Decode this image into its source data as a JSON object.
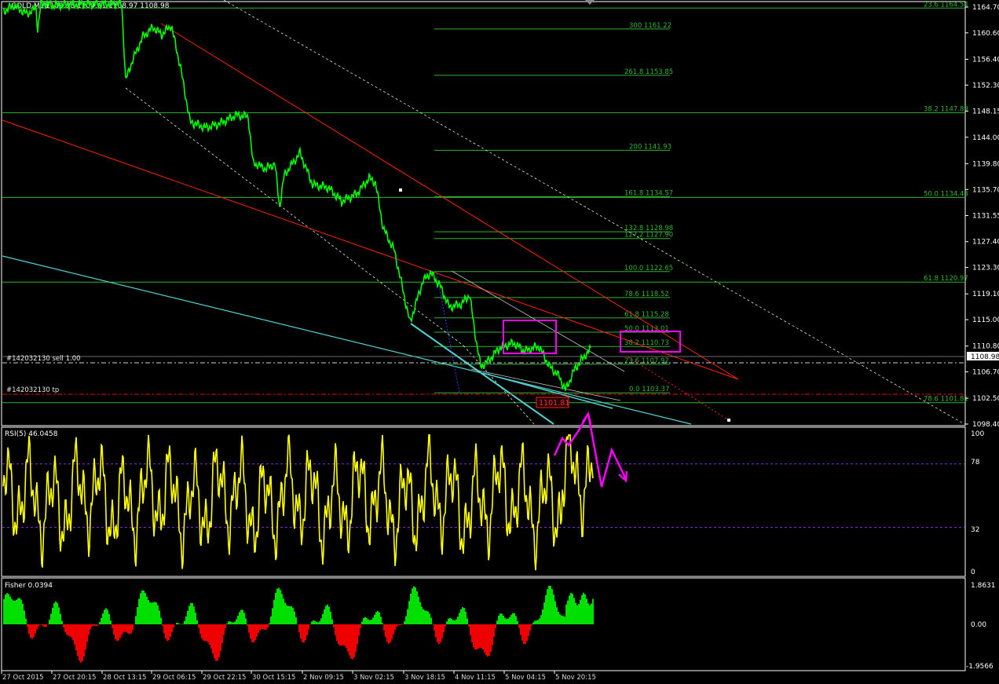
{
  "header": {
    "symbol": "GOLD,M15",
    "ohlc": "1109.38 1109.61 1108.97 1108.98"
  },
  "price_axis": {
    "ticks": [
      "1164.70",
      "1160.60",
      "1156.40",
      "1152.30",
      "1148.15",
      "1144.00",
      "1139.80",
      "1135.70",
      "1131.55",
      "1127.40",
      "1123.30",
      "1119.10",
      "1115.00",
      "1110.80",
      "1106.70",
      "1102.50",
      "1098.40"
    ],
    "current_price": "1108.98",
    "tp_label": "1101.81"
  },
  "date_axis": {
    "labels": [
      "27 Oct 2015",
      "27 Oct 20:15",
      "28 Oct 13:15",
      "29 Oct 06:15",
      "29 Oct 22:15",
      "30 Oct 15:15",
      "2 Nov 09:15",
      "3 Nov 02:15",
      "3 Nov 18:15",
      "4 Nov 11:15",
      "5 Nov 04:15",
      "5 Nov 20:15"
    ]
  },
  "orders": {
    "sell_label": "#142032130 sell 1.00",
    "tp_label": "#142032130 tp"
  },
  "fib_levels": [
    {
      "label": "23.6 1164.54",
      "price": 1164.54
    },
    {
      "label": "38.2 1147.89",
      "price": 1147.89
    },
    {
      "label": "50.0 1134.43",
      "price": 1134.43
    },
    {
      "label": "61.8 1120.97",
      "price": 1120.97
    },
    {
      "label": "78.6 1101.81",
      "price": 1101.81
    }
  ],
  "fib_ext": [
    {
      "label": "300 1161.22",
      "price": 1161.22
    },
    {
      "label": "261.8 1153.85",
      "price": 1153.85
    },
    {
      "label": "200 1141.93",
      "price": 1141.93
    },
    {
      "label": "161.8 1134.57",
      "price": 1134.57
    },
    {
      "label": "132.8 1128.98",
      "price": 1128.98
    },
    {
      "label": "127.2 1127.90",
      "price": 1127.9
    },
    {
      "label": "100.0 1122.65",
      "price": 1122.65
    },
    {
      "label": "78.6 1118.52",
      "price": 1118.52
    },
    {
      "label": "61.8 1115.28",
      "price": 1115.28
    },
    {
      "label": "50.0 1113.01",
      "price": 1113.01
    },
    {
      "label": "38.2 1110.73",
      "price": 1110.73
    },
    {
      "label": "23.6 1107.92",
      "price": 1107.92
    },
    {
      "label": "0.0 1103.37",
      "price": 1103.37
    }
  ],
  "rsi": {
    "title": "RSI(5) 46.0458",
    "ticks": [
      "100",
      "78",
      "32",
      "0"
    ],
    "levels": [
      78,
      32
    ]
  },
  "fisher": {
    "title": "Fisher 0.0394",
    "ticks": [
      "1.8631",
      "0.00",
      "-1.9566"
    ]
  },
  "colors": {
    "price": "#00ff00",
    "fib": "#2fb52f",
    "rsi": "#ffff00",
    "fisher_up": "#00e000",
    "fisher_down": "#ee0000",
    "box": "#ff00ff",
    "trend_red": "#ff2200",
    "trend_cyan": "#50d0d0",
    "channel": "#d0f0d0",
    "tp": "#ff0000"
  },
  "chart_data": {
    "type": "line",
    "series": [
      {
        "name": "GOLD,M15",
        "x": [
          "27 Oct 2015",
          "27 Oct 20:15",
          "28 Oct 13:15",
          "29 Oct 06:15",
          "29 Oct 22:15",
          "30 Oct 15:15",
          "2 Nov 09:15",
          "3 Nov 02:15",
          "3 Nov 18:15",
          "4 Nov 11:15",
          "5 Nov 04:15",
          "5 Nov 20:15"
        ],
        "values": [
          1165.5,
          1164.0,
          1160.0,
          1160.5,
          1146.0,
          1143.0,
          1136.0,
          1137.0,
          1122.5,
          1107.0,
          1109.0,
          1110.0
        ]
      }
    ],
    "ylim": [
      1097.5,
      1166.0
    ]
  }
}
